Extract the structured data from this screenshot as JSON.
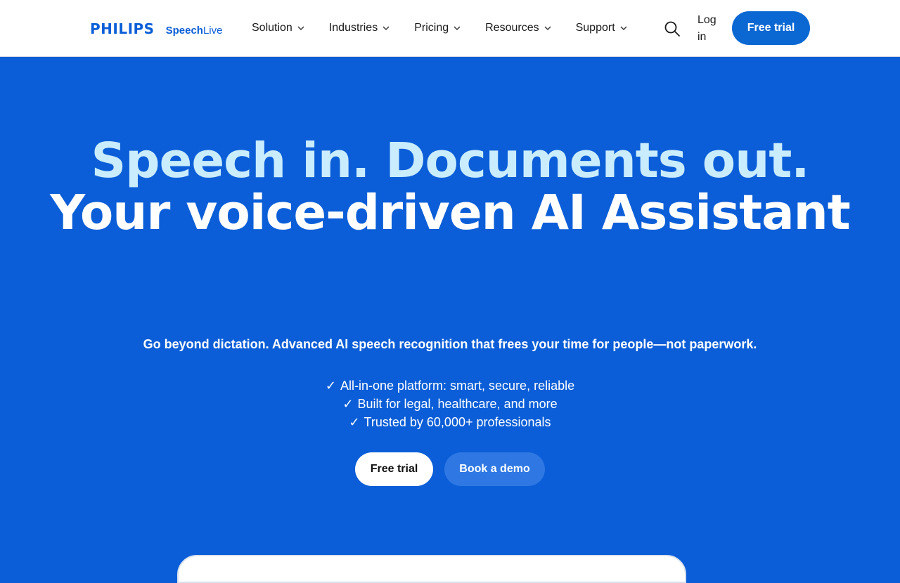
{
  "brand": {
    "logo": "PHILIPS",
    "product_bold": "Speech",
    "product_light": "Live"
  },
  "nav": {
    "items": [
      {
        "label": "Solution"
      },
      {
        "label": "Industries"
      },
      {
        "label": "Pricing"
      },
      {
        "label": "Resources"
      },
      {
        "label": "Support"
      }
    ],
    "login_label": "Log in",
    "cta_label": "Free trial"
  },
  "hero": {
    "headline_line1": "Speech in. Documents out.",
    "headline_line2": "Your voice-driven AI Assistant",
    "subheadline": "Go beyond dictation. Advanced AI speech recognition that frees your time for people—not paperwork.",
    "check_glyph": "✓",
    "bullets": [
      "All-in-one platform: smart, secure, reliable",
      "Built for legal, healthcare, and more",
      "Trusted by 60,000+ professionals"
    ],
    "primary_cta": "Free trial",
    "secondary_cta": "Book a demo"
  },
  "icons": {
    "search": "search-icon",
    "chevron": "chevron-down-icon",
    "check": "check-icon"
  },
  "colors": {
    "brand_blue": "#0b5ed7",
    "header_cta": "#0b68d3",
    "headline_light": "#c9ecff",
    "secondary_button": "#2f78e3"
  }
}
